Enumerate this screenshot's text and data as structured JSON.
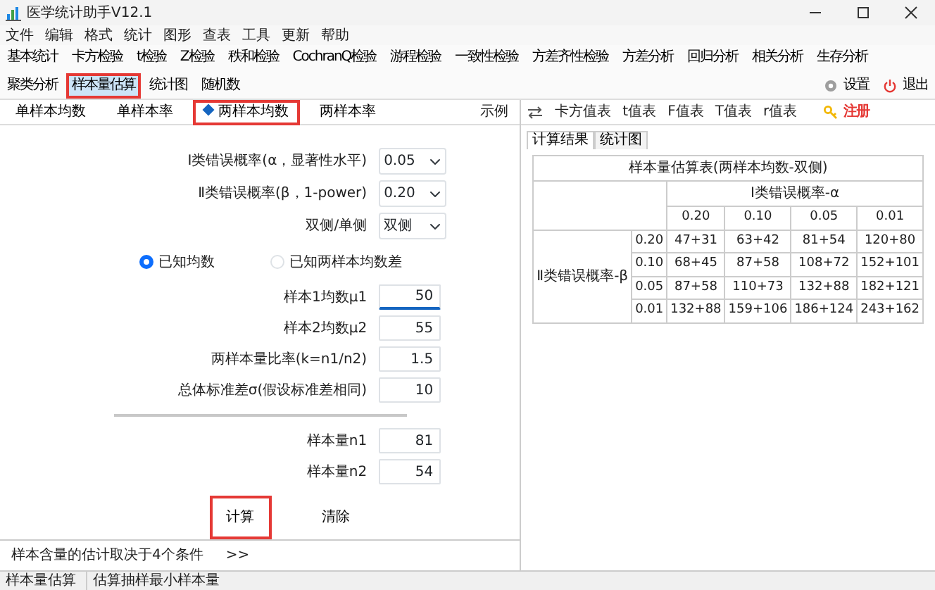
{
  "window": {
    "title": "医学统计助手V12.1"
  },
  "menu": [
    "文件",
    "编辑",
    "格式",
    "统计",
    "图形",
    "查表",
    "工具",
    "更新",
    "帮助"
  ],
  "toolbar": {
    "items": [
      {
        "label": "基本统计",
        "selected": false,
        "highlighted": false
      },
      {
        "label": "卡方检验",
        "selected": false,
        "highlighted": false
      },
      {
        "label": "t检验",
        "selected": false,
        "highlighted": false
      },
      {
        "label": "Z检验",
        "selected": false,
        "highlighted": false
      },
      {
        "label": "秩和检验",
        "selected": false,
        "highlighted": false
      },
      {
        "label": "CochranQ检验",
        "selected": false,
        "highlighted": false
      },
      {
        "label": "游程检验",
        "selected": false,
        "highlighted": false
      },
      {
        "label": "一致性检验",
        "selected": false,
        "highlighted": false
      },
      {
        "label": "方差齐性检验",
        "selected": false,
        "highlighted": false
      },
      {
        "label": "方差分析",
        "selected": false,
        "highlighted": false
      },
      {
        "label": "回归分析",
        "selected": false,
        "highlighted": false
      },
      {
        "label": "相关分析",
        "selected": false,
        "highlighted": false
      },
      {
        "label": "生存分析",
        "selected": false,
        "highlighted": false
      },
      {
        "label": "聚类分析",
        "selected": false,
        "highlighted": false
      },
      {
        "label": "样本量估算",
        "selected": true,
        "highlighted": true
      },
      {
        "label": "统计图",
        "selected": false,
        "highlighted": false
      },
      {
        "label": "随机数",
        "selected": false,
        "highlighted": false
      }
    ],
    "settings": "设置",
    "exit": "退出"
  },
  "method_tabs": [
    {
      "label": "单样本均数",
      "selected": false,
      "highlighted": false
    },
    {
      "label": "单样本率",
      "selected": false,
      "highlighted": false
    },
    {
      "label": "两样本均数",
      "selected": true,
      "highlighted": true
    },
    {
      "label": "两样本率",
      "selected": false,
      "highlighted": false
    }
  ],
  "example_link": "示例",
  "form": {
    "selects": [
      {
        "label": "Ⅰ类错误概率(α，显著性水平)",
        "value": "0.05"
      },
      {
        "label": "Ⅱ类错误概率(β，1-power)",
        "value": "0.20"
      },
      {
        "label": "双侧/单侧",
        "value": "双侧"
      }
    ],
    "radios": [
      {
        "label": "已知均数",
        "selected": true
      },
      {
        "label": "已知两样本均数差",
        "selected": false
      }
    ],
    "inputs": [
      {
        "label": "样本1均数μ1",
        "value": "50",
        "focused": true
      },
      {
        "label": "样本2均数μ2",
        "value": "55",
        "focused": false
      },
      {
        "label": "两样本量比率(k=n1/n2)",
        "value": "1.5",
        "focused": false
      },
      {
        "label": "总体标准差σ(假设标准差相同)",
        "value": "10",
        "focused": false
      }
    ],
    "outputs": [
      {
        "label": "样本量n1",
        "value": "81"
      },
      {
        "label": "样本量n2",
        "value": "54"
      }
    ],
    "buttons": [
      {
        "label": "计算",
        "highlighted": true
      },
      {
        "label": "清除",
        "highlighted": false
      }
    ]
  },
  "info_bar": {
    "text": "样本含量的估计取决于4个条件",
    "more": ">>"
  },
  "table_toolbar": {
    "items": [
      "卡方值表",
      "t值表",
      "F值表",
      "T值表",
      "r值表"
    ],
    "register": "注册"
  },
  "result_tabs": [
    {
      "label": "计算结果",
      "selected": true
    },
    {
      "label": "统计图",
      "selected": false
    }
  ],
  "result_table": {
    "title": "样本量估算表(两样本均数-双侧)",
    "column_group": "Ⅰ类错误概率-α",
    "columns": [
      "0.20",
      "0.10",
      "0.05",
      "0.01"
    ],
    "row_group": "Ⅱ类错误概率-β",
    "rows": [
      {
        "label": "0.20",
        "cells": [
          "47+31",
          "63+42",
          "81+54",
          "120+80"
        ]
      },
      {
        "label": "0.10",
        "cells": [
          "68+45",
          "87+58",
          "108+72",
          "152+101"
        ]
      },
      {
        "label": "0.05",
        "cells": [
          "87+58",
          "110+73",
          "132+88",
          "182+121"
        ]
      },
      {
        "label": "0.01",
        "cells": [
          "132+88",
          "159+106",
          "186+124",
          "243+162"
        ]
      }
    ]
  },
  "status_bar": [
    "样本量估算",
    "估算抽样最小样本量"
  ]
}
